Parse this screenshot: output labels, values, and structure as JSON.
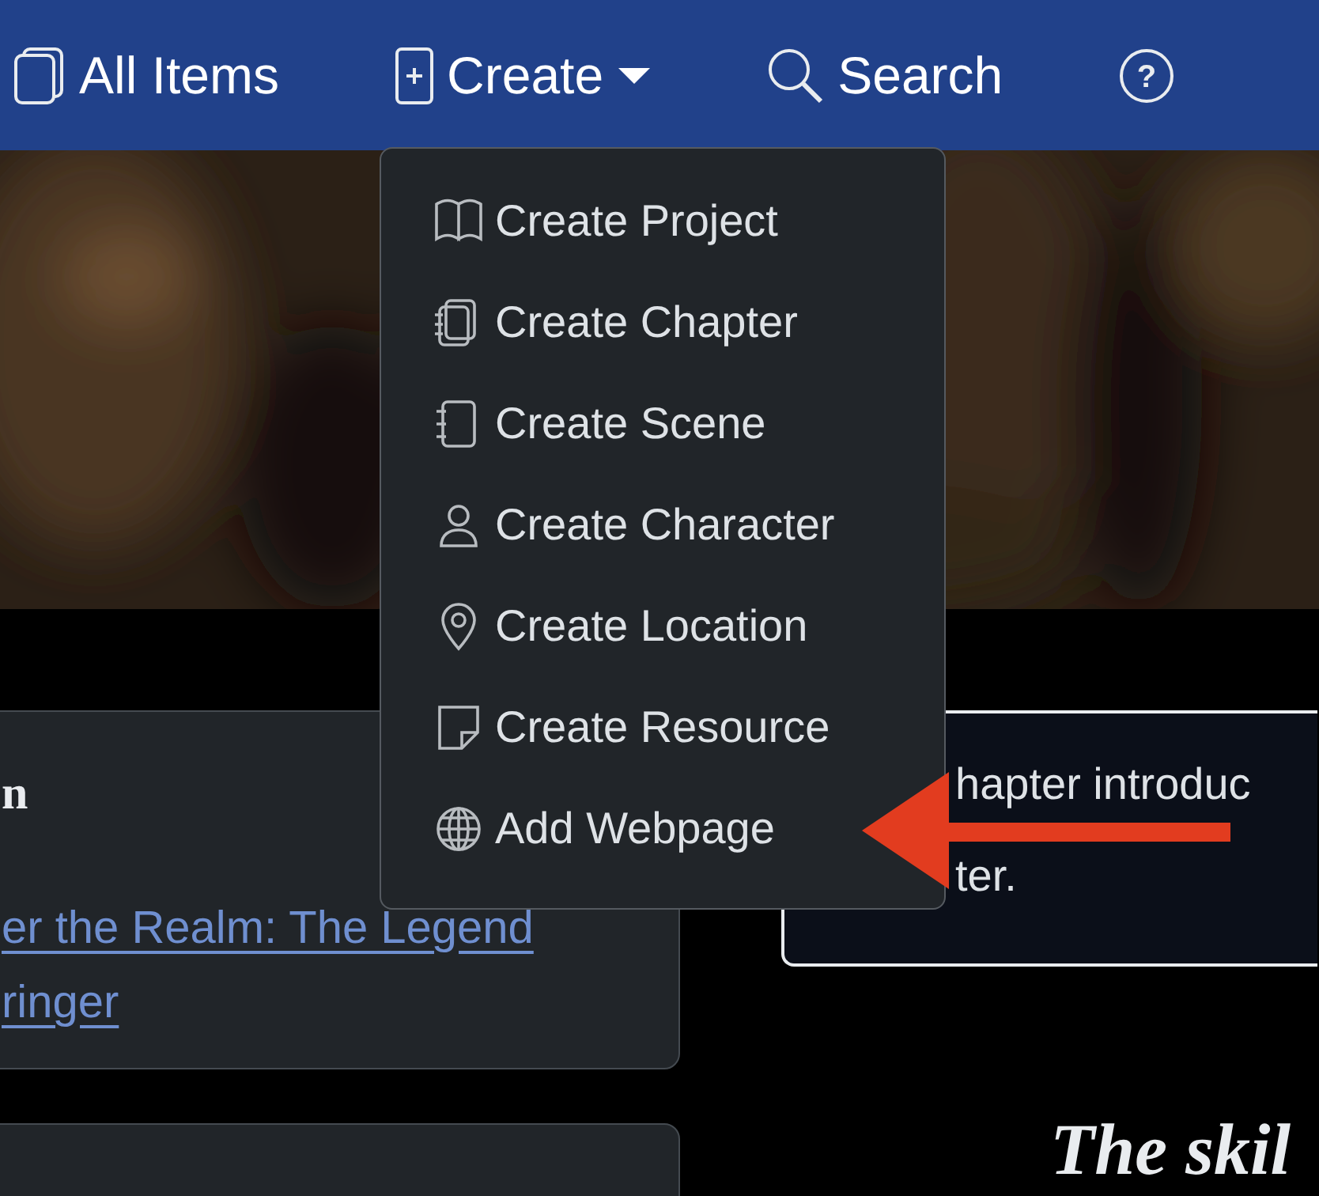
{
  "navbar": {
    "items": [
      {
        "kind": "link",
        "label": "All Items"
      },
      {
        "kind": "dropdown",
        "label": "Create",
        "expanded": true
      },
      {
        "kind": "link",
        "label": "Search"
      },
      {
        "kind": "icon",
        "glyph": "?"
      }
    ]
  },
  "create_menu": {
    "items": [
      {
        "label": "Create Project"
      },
      {
        "label": "Create Chapter"
      },
      {
        "label": "Create Scene"
      },
      {
        "label": "Create Character"
      },
      {
        "label": "Create Location"
      },
      {
        "label": "Create Resource"
      },
      {
        "label": "Add Webpage"
      }
    ]
  },
  "project_card": {
    "title": "n",
    "link": "er the Realm: The Legend\nringer"
  },
  "summary_box": {
    "lines": [
      "hapter introduc",
      "ter."
    ]
  },
  "heading": "The skil"
}
